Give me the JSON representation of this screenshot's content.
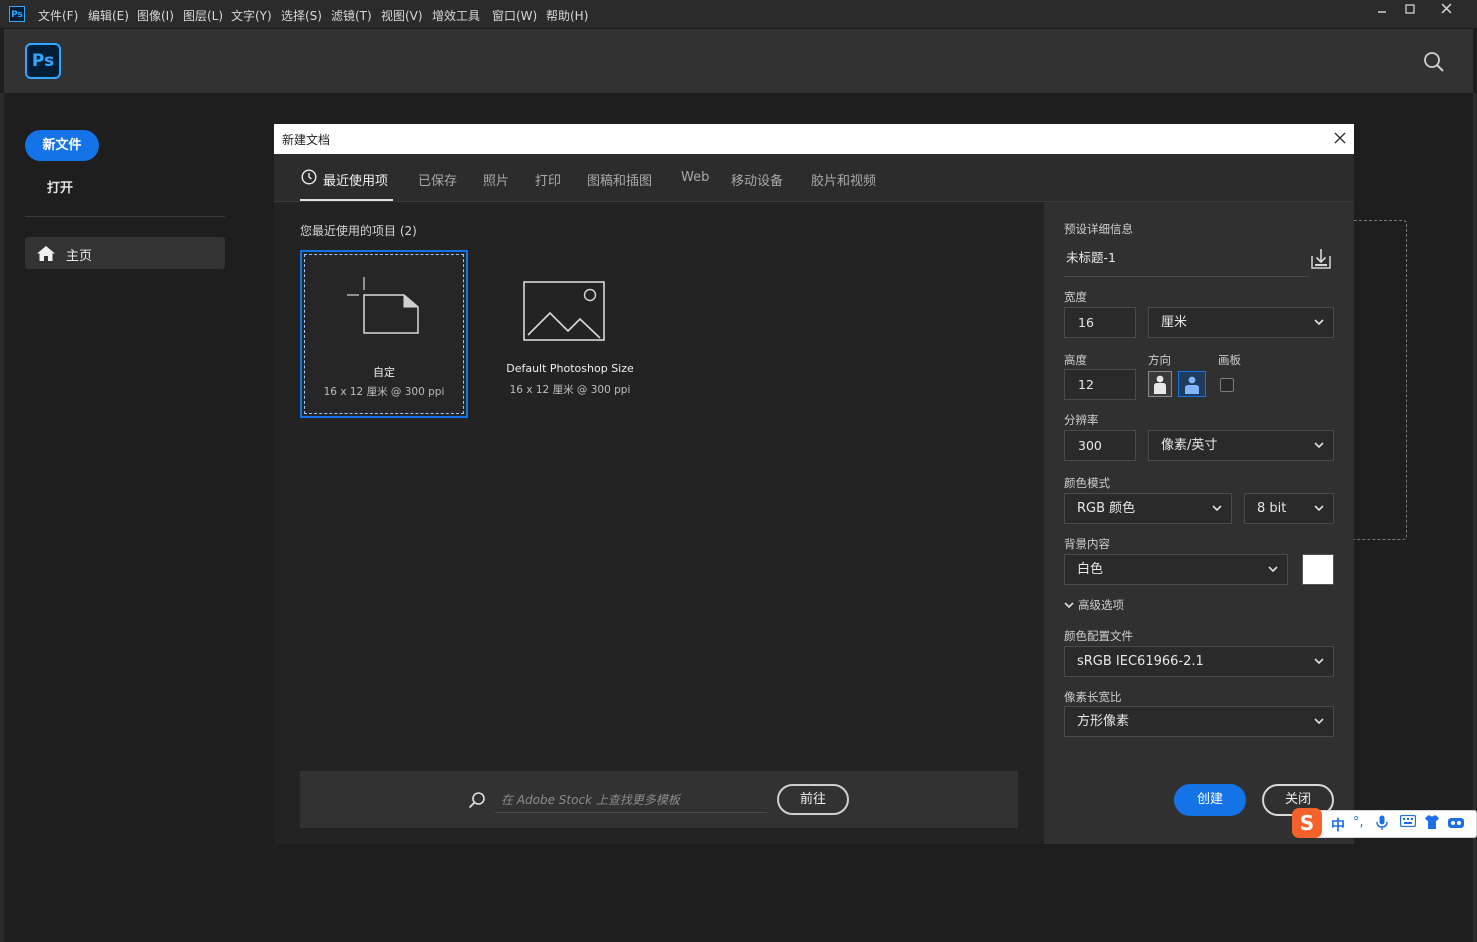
{
  "menubar": {
    "app_icon": "Ps",
    "items": [
      "文件(F)",
      "编辑(E)",
      "图像(I)",
      "图层(L)",
      "文字(Y)",
      "选择(S)",
      "滤镜(T)",
      "视图(V)",
      "增效工具",
      "窗口(W)",
      "帮助(H)"
    ],
    "window_controls": [
      "minimize-icon",
      "maximize-icon",
      "close-icon"
    ]
  },
  "header": {
    "logo": "Ps",
    "search_icon": "search-icon"
  },
  "sidebar": {
    "new_file": "新文件",
    "open": "打开",
    "home": "主页"
  },
  "dialog": {
    "title": "新建文档",
    "close_glyph": "×",
    "tabs": [
      "最近使用项",
      "已保存",
      "照片",
      "打印",
      "图稿和插图",
      "Web",
      "移动设备",
      "胶片和视频"
    ],
    "active_tab": "最近使用项",
    "recent_title": "您最近使用的项目 (2)",
    "cards": [
      {
        "name": "自定",
        "dims": "16 x 12 厘米 @ 300 ppi",
        "selected": true
      },
      {
        "name": "Default Photoshop Size",
        "dims": "16 x 12 厘米 @ 300 ppi",
        "selected": false
      }
    ],
    "stock": {
      "placeholder": "在 Adobe Stock 上查找更多模板",
      "button": "前往"
    }
  },
  "preset": {
    "section_label": "预设详细信息",
    "name": "未标题-1",
    "width_label": "宽度",
    "width": "16",
    "width_unit": "厘米",
    "height_label": "高度",
    "height": "12",
    "orientation_label": "方向",
    "orientation": "landscape",
    "artboard_label": "画板",
    "artboard_checked": false,
    "resolution_label": "分辨率",
    "resolution": "300",
    "resolution_unit": "像素/英寸",
    "color_mode_label": "颜色模式",
    "color_mode": "RGB 颜色",
    "bit_depth": "8 bit",
    "bg_label": "背景内容",
    "bg": "白色",
    "bg_color": "#ffffff",
    "advanced_label": "高级选项",
    "profile_label": "颜色配置文件",
    "profile": "sRGB IEC61966-2.1",
    "aspect_label": "像素长宽比",
    "aspect": "方形像素",
    "create": "创建",
    "close": "关闭"
  },
  "ime": {
    "logo": "S",
    "mode": "中",
    "icons": [
      {
        "name": "punctuation-icon",
        "glyph": "°,"
      },
      {
        "name": "microphone-icon",
        "glyph": "🎤"
      },
      {
        "name": "keyboard-icon",
        "glyph": "⌨"
      },
      {
        "name": "skin-icon",
        "glyph": "👕"
      },
      {
        "name": "toolbox-icon",
        "glyph": "⚙"
      }
    ]
  },
  "colors": {
    "accent": "#1473e6",
    "ps_blue": "#31a8ff",
    "panel": "#303030",
    "dialog_bg": "#232323"
  }
}
